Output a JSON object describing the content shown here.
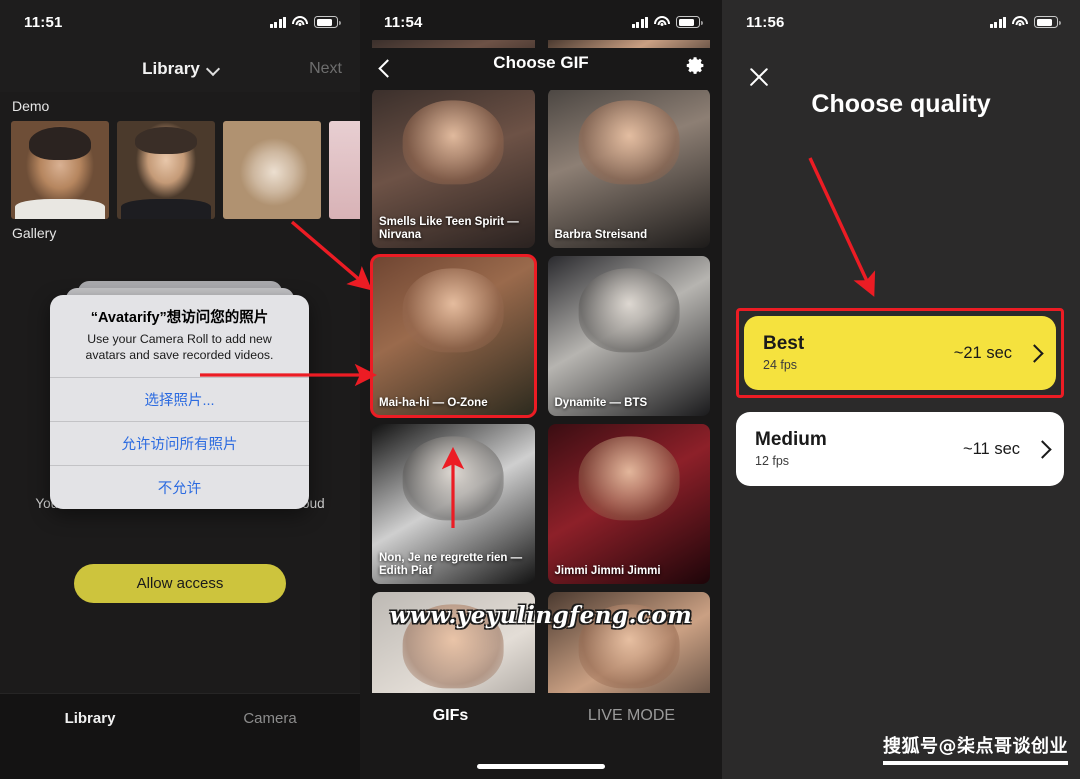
{
  "panels": {
    "library": {
      "status": {
        "time": "11:51"
      },
      "nav": {
        "title": "Library",
        "chevron_icon": "chevron-down-icon",
        "next_label": "Next"
      },
      "sections": [
        {
          "label": "Demo"
        },
        {
          "label": "Gallery"
        }
      ],
      "permission_dialog": {
        "title": "“Avatarify”想访问您的照片",
        "message": "Use your Camera Roll to add new avatars and save recorded videos.",
        "buttons": [
          "选择照片...",
          "允许访问所有照片",
          "不允许"
        ]
      },
      "secure_note": "Your data is secured and never sent to the cloud",
      "allow_button": "Allow access",
      "tabs": [
        {
          "label": "Library",
          "active": true
        },
        {
          "label": "Camera",
          "active": false
        }
      ]
    },
    "choose_gif": {
      "status": {
        "time": "11:54"
      },
      "nav": {
        "back_icon": "chevron-left-icon",
        "title": "Choose GIF",
        "settings_icon": "gear-icon"
      },
      "gifs": [
        {
          "caption": "Smells Like Teen Spirit — Nirvana",
          "selected": false
        },
        {
          "caption": "Barbra Streisand",
          "selected": false
        },
        {
          "caption": "Mai-ha-hi — O-Zone",
          "selected": true
        },
        {
          "caption": "Dynamite — BTS",
          "selected": false
        },
        {
          "caption": "Non, Je ne regrette rien — Edith Piaf",
          "selected": false
        },
        {
          "caption": "Jimmi Jimmi Jimmi",
          "selected": false
        },
        {
          "caption": "",
          "selected": false
        },
        {
          "caption": "",
          "selected": false
        }
      ],
      "tabs": [
        {
          "label": "GIFs",
          "active": true
        },
        {
          "label": "LIVE MODE",
          "active": false
        }
      ],
      "watermark": "www.yeyulingfeng.com"
    },
    "choose_quality": {
      "status": {
        "time": "11:56"
      },
      "close_icon": "close-icon",
      "title": "Choose quality",
      "options": [
        {
          "name": "Best",
          "fps": "24 fps",
          "time": "~21 sec",
          "selected": true,
          "chevron_icon": "chevron-right-icon"
        },
        {
          "name": "Medium",
          "fps": "12 fps",
          "time": "~11 sec",
          "selected": false,
          "chevron_icon": "chevron-right-icon"
        }
      ],
      "watermark": "搜狐号@柒点哥谈创业"
    }
  },
  "colors": {
    "background": "#1e1d1d",
    "accent_yellow": "#f5e23e",
    "button_yellow": "#cdc43d",
    "annotation_red": "#ec1c24",
    "dialog_blue": "#2c6be0"
  },
  "annotations": {
    "arrow_count": 4,
    "highlight_boxes": 2
  }
}
